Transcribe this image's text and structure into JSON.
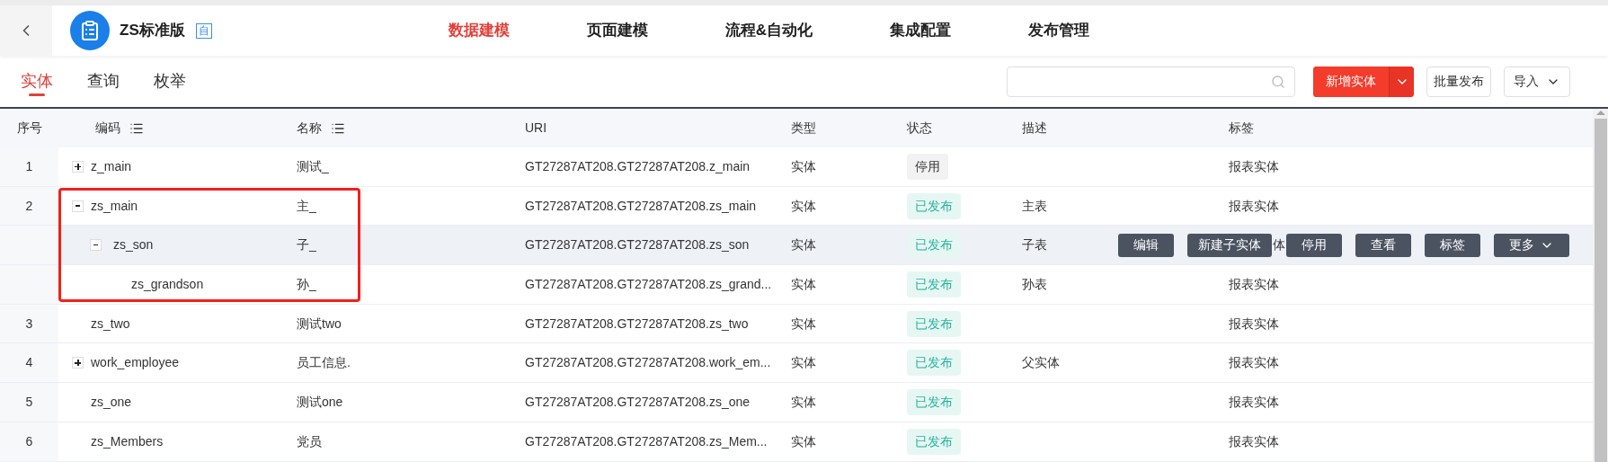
{
  "app": {
    "title": "ZS标准版",
    "badge": "自"
  },
  "nav": [
    {
      "label": "数据建模",
      "selected": true
    },
    {
      "label": "页面建模",
      "selected": false
    },
    {
      "label": "流程&自动化",
      "selected": false
    },
    {
      "label": "集成配置",
      "selected": false
    },
    {
      "label": "发布管理",
      "selected": false
    }
  ],
  "tabs": [
    {
      "label": "实体",
      "selected": true
    },
    {
      "label": "查询",
      "selected": false
    },
    {
      "label": "枚举",
      "selected": false
    }
  ],
  "toolbar": {
    "primary": "新增实体",
    "buttons": [
      "批量发布"
    ],
    "import": "导入"
  },
  "table": {
    "columns": [
      "序号",
      "编码",
      "名称",
      "URI",
      "类型",
      "状态",
      "描述",
      "标签"
    ],
    "rows": [
      {
        "index": "1",
        "code": "z_main",
        "name": "测试_",
        "uri": "GT27287AT208.GT27287AT208.z_main",
        "type": "实体",
        "status": {
          "text": "停用",
          "kind": "disabled"
        },
        "desc": "",
        "tag": "报表实体",
        "expanded": false
      },
      {
        "index": "2",
        "code": "zs_main",
        "name": "主_",
        "uri": "GT27287AT208.GT27287AT208.zs_main",
        "type": "实体",
        "status": {
          "text": "已发布",
          "kind": "published"
        },
        "desc": "主表",
        "tag": "报表实体",
        "expanded": true,
        "children": [
          {
            "code": "zs_son",
            "name": "子_",
            "uri": "GT27287AT208.GT27287AT208.zs_son",
            "type": "实体",
            "status": {
              "text": "已发布",
              "kind": "published"
            },
            "desc": "子表",
            "tag": "体",
            "expanded": true,
            "hovered": true,
            "actions": [
              "编辑",
              "新建子实体",
              "停用",
              "查看",
              "标签",
              "更多"
            ],
            "children": [
              {
                "code": "zs_grandson",
                "name": "孙_",
                "uri": "GT27287AT208.GT27287AT208.zs_grand...",
                "type": "实体",
                "status": {
                  "text": "已发布",
                  "kind": "published"
                },
                "desc": "孙表",
                "tag": "报表实体"
              }
            ]
          }
        ]
      },
      {
        "index": "3",
        "code": "zs_two",
        "name": "测试two",
        "uri": "GT27287AT208.GT27287AT208.zs_two",
        "type": "实体",
        "status": {
          "text": "已发布",
          "kind": "published"
        },
        "desc": "",
        "tag": "报表实体"
      },
      {
        "index": "4",
        "code": "work_employee",
        "name": "员工信息.",
        "uri": "GT27287AT208.GT27287AT208.work_em...",
        "type": "实体",
        "status": {
          "text": "已发布",
          "kind": "published"
        },
        "desc": "父实体",
        "tag": "报表实体",
        "expanded": false
      },
      {
        "index": "5",
        "code": "zs_one",
        "name": "测试one",
        "uri": "GT27287AT208.GT27287AT208.zs_one",
        "type": "实体",
        "status": {
          "text": "已发布",
          "kind": "published"
        },
        "desc": "",
        "tag": "报表实体"
      },
      {
        "index": "6",
        "code": "zs_Members",
        "name": "党员",
        "uri": "GT27287AT208.GT27287AT208.zs_Mem...",
        "type": "实体",
        "status": {
          "text": "已发布",
          "kind": "published"
        },
        "desc": "",
        "tag": "报表实体"
      }
    ]
  }
}
